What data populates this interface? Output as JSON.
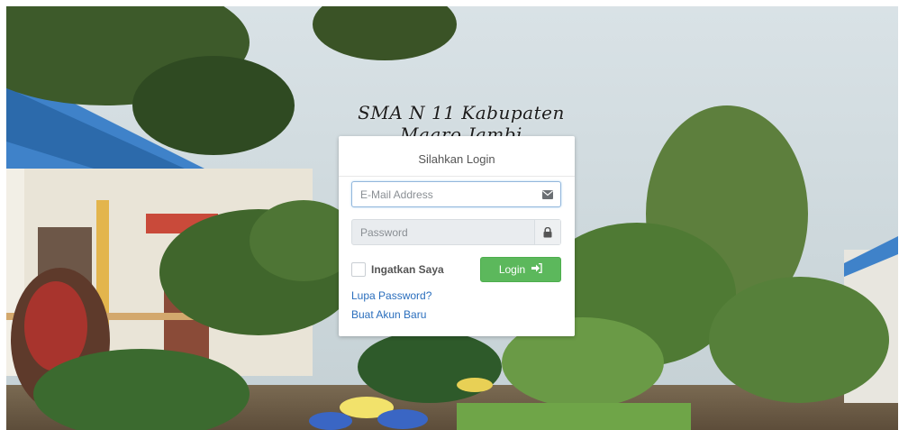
{
  "site": {
    "title": "SMA N 11 Kabupaten Maaro Jambi"
  },
  "login_panel": {
    "heading": "Silahkan Login",
    "email": {
      "placeholder": "E-Mail Address",
      "value": "",
      "icon": "envelope-icon"
    },
    "password": {
      "placeholder": "Password",
      "value": "",
      "icon": "lock-icon"
    },
    "remember": {
      "label": "Ingatkan Saya",
      "checked": false
    },
    "login_button": {
      "label": "Login",
      "icon": "sign-in-icon",
      "color": "#5cb85c"
    },
    "forgot_link": "Lupa Password?",
    "register_link": "Buat Akun Baru"
  },
  "colors": {
    "link": "#2a6ebd",
    "button": "#5cb85c"
  }
}
